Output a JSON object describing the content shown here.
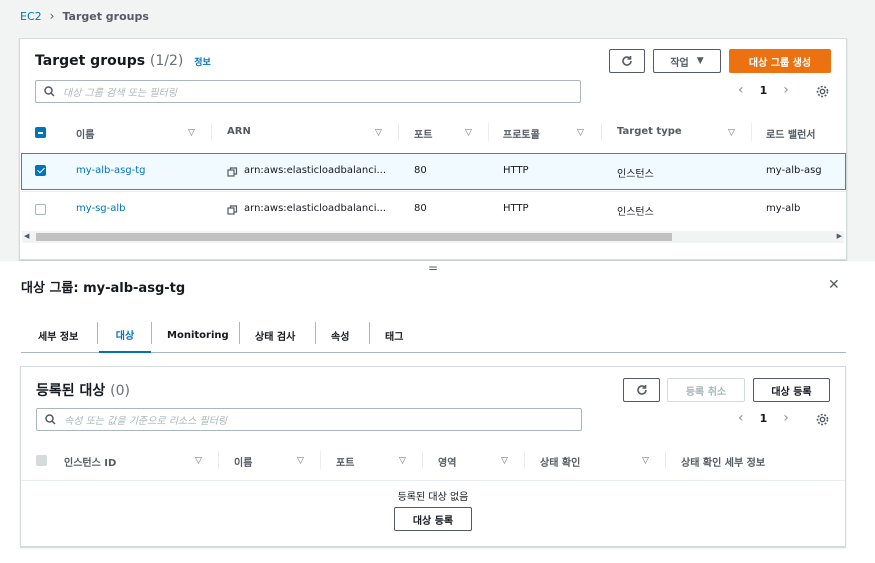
{
  "breadcrumb": {
    "root": "EC2",
    "current": "Target groups"
  },
  "target_groups": {
    "title": "Target groups",
    "count": "(1/2)",
    "info_label": "정보",
    "actions_label": "작업",
    "create_label": "대상 그룹 생성",
    "search_placeholder": "대상 그룹 검색 또는 필터링",
    "page": "1",
    "columns": [
      "이름",
      "ARN",
      "포트",
      "프로토콜",
      "Target type",
      "로드 밸런서"
    ],
    "rows": [
      {
        "name": "my-alb-asg-tg",
        "arn": "arn:aws:elasticloadbalanci...",
        "port": "80",
        "protocol": "HTTP",
        "target_type": "인스턴스",
        "lb": "my-alb-asg",
        "selected": true
      },
      {
        "name": "my-sg-alb",
        "arn": "arn:aws:elasticloadbalanci...",
        "port": "80",
        "protocol": "HTTP",
        "target_type": "인스턴스",
        "lb": "my-alb",
        "selected": false
      }
    ]
  },
  "splitter_glyph": "=",
  "detail": {
    "title": "대상 그룹: my-alb-asg-tg",
    "tabs": [
      "세부 정보",
      "대상",
      "Monitoring",
      "상태 검사",
      "속성",
      "태그"
    ],
    "active_tab": "대상",
    "registered": {
      "title": "등록된 대상",
      "count": "(0)",
      "deregister_label": "등록 취소",
      "register_label": "대상 등록",
      "search_placeholder": "속성 또는 값을 기준으로 리소스 필터링",
      "page": "1",
      "columns": [
        "인스턴스 ID",
        "이름",
        "포트",
        "영역",
        "상태 확인",
        "상태 확인 세부 정보"
      ],
      "empty_text": "등록된 대상 없음",
      "empty_button": "대상 등록"
    }
  },
  "colors": {
    "accent": "#0073bb",
    "primary": "#ec7211",
    "selected_border": "#00a1c9"
  }
}
